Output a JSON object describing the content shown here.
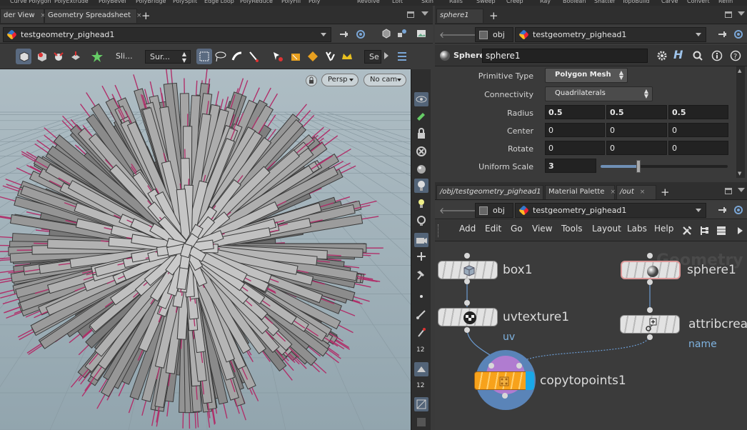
{
  "shelf": [
    "Curve Polygon",
    "PolyExtrude",
    "PolyBevel",
    "PolyBridge",
    "PolySplit",
    "Edge Loop",
    "PolyReduce",
    "PolyFill",
    "Poly",
    "Revolve",
    "Loft",
    "Skin",
    "Rails",
    "Sweep",
    "Creep",
    "Ray",
    "Boolean",
    "Shatter",
    "TopoBuild",
    "Carve",
    "Convert",
    "Refin"
  ],
  "left_tabs": [
    {
      "label": "der View",
      "close": "×"
    },
    {
      "label": "Geometry Spreadsheet",
      "close": "×"
    }
  ],
  "left_path": {
    "node": "testgeometry_pighead1"
  },
  "viewport_toolbar": {
    "sli_label": "Sli...",
    "sur_label": "Sur...",
    "se_label": "Se"
  },
  "viewport": {
    "persp": "Persp",
    "cam": "No cam"
  },
  "param_tab": {
    "label": "sphere1"
  },
  "param_path": {
    "context": "obj",
    "node": "testgeometry_pighead1"
  },
  "param_header": {
    "type": "Sphere",
    "name": "sphere1"
  },
  "params": {
    "primitive_type": {
      "label": "Primitive Type",
      "value": "Polygon Mesh"
    },
    "connectivity": {
      "label": "Connectivity",
      "value": "Quadrilaterals"
    },
    "radius": {
      "label": "Radius",
      "values": [
        "0.5",
        "0.5",
        "0.5"
      ]
    },
    "center": {
      "label": "Center",
      "values": [
        "0",
        "0",
        "0"
      ]
    },
    "rotate": {
      "label": "Rotate",
      "values": [
        "0",
        "0",
        "0"
      ]
    },
    "uniform_scale": {
      "label": "Uniform Scale",
      "value": "3",
      "slider_fraction": 0.3
    }
  },
  "net_tabs": [
    {
      "label": "/obj/testgeometry_pighead1",
      "close": "×"
    },
    {
      "label": "Material Palette",
      "close": "×"
    },
    {
      "label": "/out",
      "close": "×"
    }
  ],
  "net_path": {
    "context": "obj",
    "node": "testgeometry_pighead1"
  },
  "net_menu": [
    "Add",
    "Edit",
    "Go",
    "View",
    "Tools",
    "Layout",
    "Labs",
    "Help"
  ],
  "network": {
    "watermark": "Geometry",
    "nodes": {
      "box1": "box1",
      "uvtexture1": "uvtexture1",
      "uvtexture_flag": "uv",
      "sphere1": "sphere1",
      "attribcreate": "attribcreat",
      "attribcreate_flag": "name",
      "copytopoints1": "copytopoints1"
    }
  },
  "vtool_labels": [
    "12",
    "12"
  ],
  "colors": {
    "accent": "#5a6a80",
    "node_wire": "#6b9bd1",
    "spike": "#b0306a",
    "copy_node": "#f7a21b"
  }
}
